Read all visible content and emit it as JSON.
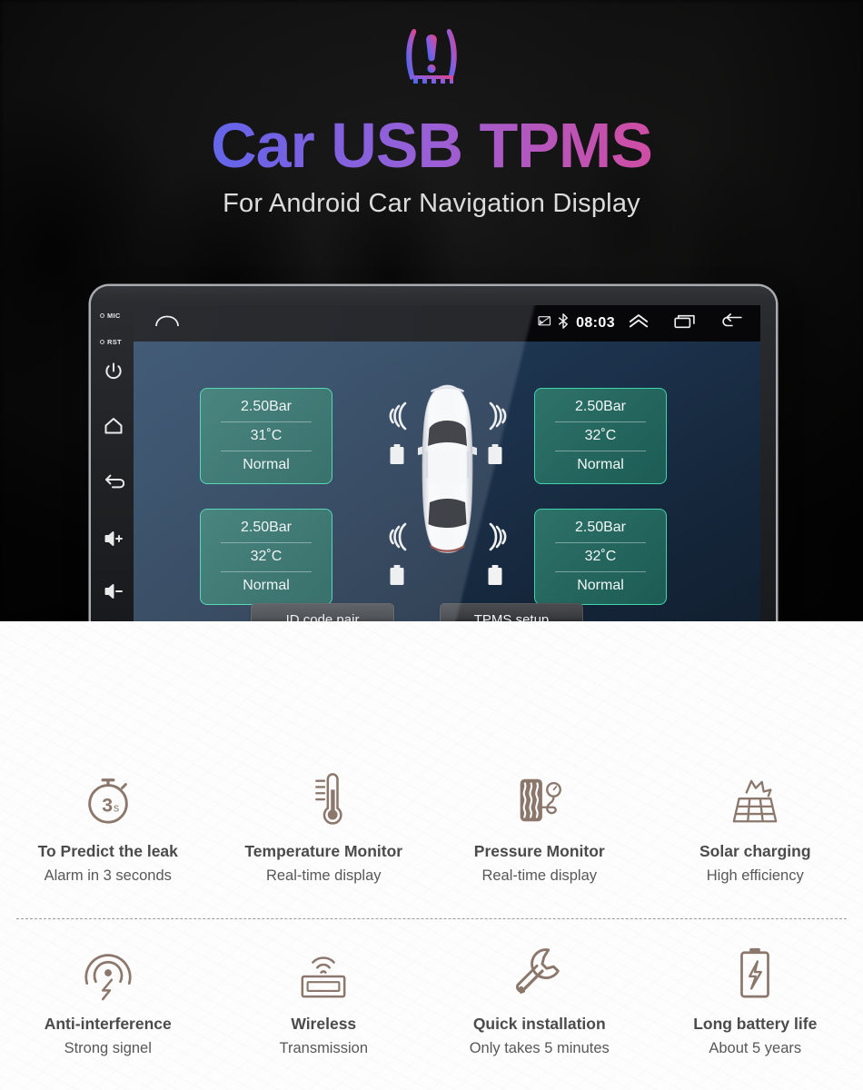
{
  "hero": {
    "warning_icon": "tpms-warning-icon",
    "title_parts": [
      {
        "text": "Car ",
        "color": "#3d7df5"
      },
      {
        "text": "USB ",
        "color": "#8a5fdd"
      },
      {
        "text": "TPMS",
        "color": "#ef3f7e"
      }
    ],
    "title": "Car USB TPMS",
    "subtitle": "For Android Car Navigation Display",
    "gradient_start": "#3d7df5",
    "gradient_end": "#ef3f7e"
  },
  "device": {
    "side_rail": {
      "labels": [
        {
          "icon": "circle-indicator-icon",
          "text": "MIC"
        },
        {
          "icon": "circle-indicator-icon",
          "text": "RST"
        }
      ],
      "buttons": [
        {
          "icon": "power-icon",
          "name": "power-button"
        },
        {
          "icon": "home-icon",
          "name": "home-button"
        },
        {
          "icon": "back-arrow-icon",
          "name": "back-button"
        },
        {
          "icon": "volume-up-icon",
          "name": "volume-up-button"
        },
        {
          "icon": "volume-down-icon",
          "name": "volume-down-button"
        }
      ]
    },
    "statusbar": {
      "home_icon": "home-outline-icon",
      "cast_icon": "screen-cast-icon",
      "bluetooth_icon": "bluetooth-icon",
      "clock": "08:03",
      "expand_icon": "chevron-double-up-icon",
      "recents_icon": "recent-apps-icon",
      "back_icon": "back-arrow-icon"
    },
    "app": {
      "vehicle_icon": "car-top-view-icon",
      "tires": [
        {
          "position": "front-left",
          "pressure": "2.50Bar",
          "temperature": "31˚C",
          "status": "Normal",
          "signal_icon": "signal-waves-icon",
          "battery_icon": "sensor-battery-icon"
        },
        {
          "position": "front-right",
          "pressure": "2.50Bar",
          "temperature": "32˚C",
          "status": "Normal",
          "signal_icon": "signal-waves-icon",
          "battery_icon": "sensor-battery-icon"
        },
        {
          "position": "rear-left",
          "pressure": "2.50Bar",
          "temperature": "32˚C",
          "status": "Normal",
          "signal_icon": "signal-waves-icon",
          "battery_icon": "sensor-battery-icon"
        },
        {
          "position": "rear-right",
          "pressure": "2.50Bar",
          "temperature": "32˚C",
          "status": "Normal",
          "signal_icon": "signal-waves-icon",
          "battery_icon": "sensor-battery-icon"
        }
      ],
      "buttons": [
        {
          "label": "ID code pair"
        },
        {
          "label": "TPMS setup"
        }
      ],
      "card_border_color": "#3fd6ad",
      "screen_bg_color": "#1b3049"
    }
  },
  "features": {
    "icon_color": "#8b776c",
    "title_color": "#4b4b4b",
    "row1": [
      {
        "icon": "stopwatch-3s-icon",
        "badge": "3",
        "badge_unit": "s",
        "title": "To Predict the leak",
        "subtitle": "Alarm in 3 seconds"
      },
      {
        "icon": "thermometer-icon",
        "title": "Temperature Monitor",
        "subtitle": "Real-time display"
      },
      {
        "icon": "tire-pressure-gauge-icon",
        "title": "Pressure Monitor",
        "subtitle": "Real-time display"
      },
      {
        "icon": "solar-panel-icon",
        "title": "Solar charging",
        "subtitle": "High efficiency"
      }
    ],
    "row2": [
      {
        "icon": "anti-interference-signal-icon",
        "title": "Anti-interference",
        "subtitle": "Strong signel"
      },
      {
        "icon": "wireless-transmission-icon",
        "title": "Wireless",
        "subtitle": "Transmission"
      },
      {
        "icon": "wrench-icon",
        "title": "Quick installation",
        "subtitle": "Only takes 5 minutes"
      },
      {
        "icon": "battery-bolt-icon",
        "title": "Long battery life",
        "subtitle": "About 5 years"
      }
    ]
  }
}
